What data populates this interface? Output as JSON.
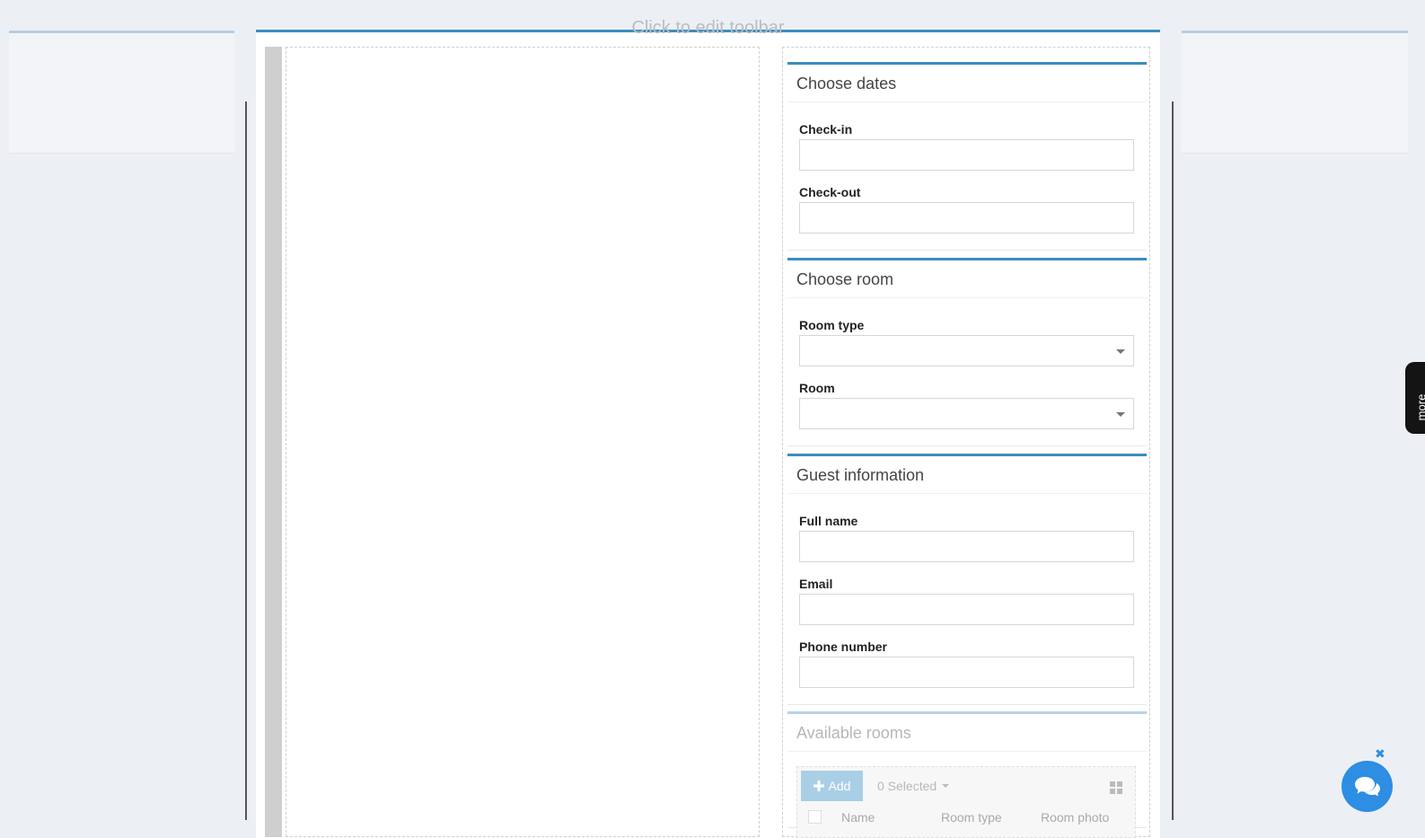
{
  "toolbar": {
    "hint": "Click to edit toolbar"
  },
  "sections": {
    "dates": {
      "title": "Choose dates",
      "checkin_label": "Check-in",
      "checkout_label": "Check-out"
    },
    "room": {
      "title": "Choose room",
      "room_type_label": "Room type",
      "room_label": "Room"
    },
    "guest": {
      "title": "Guest information",
      "full_name_label": "Full name",
      "email_label": "Email",
      "phone_label": "Phone number"
    },
    "available": {
      "title": "Available rooms",
      "add_label": "Add",
      "selected_label": "0 Selected",
      "columns": [
        "Name",
        "Room type",
        "Room photo"
      ]
    }
  },
  "more_tab": {
    "label": "more"
  },
  "chat": {
    "close_symbol": "✖",
    "icon": "chat-bubbles-icon"
  },
  "colors": {
    "accent": "#3c8dbc",
    "background": "#ecf0f5",
    "chat": "#2d8ee3"
  }
}
